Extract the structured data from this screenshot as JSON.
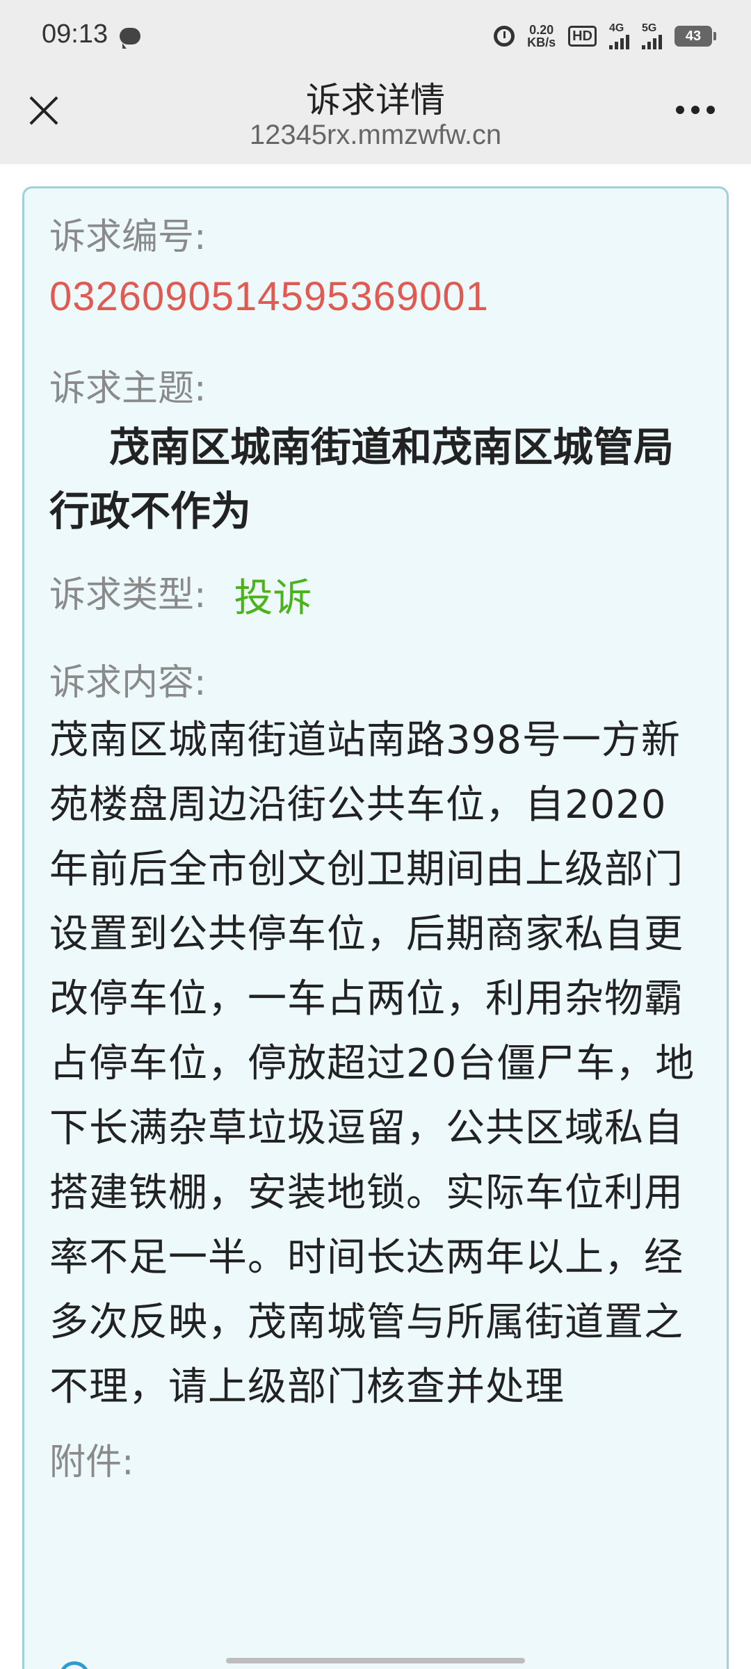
{
  "status_bar": {
    "time": "09:13",
    "net_speed_value": "0.20",
    "net_speed_unit": "KB/s",
    "hd": "HD",
    "sig1": "4G",
    "sig2": "5G",
    "battery": "43"
  },
  "nav": {
    "title": "诉求详情",
    "url": "12345rx.mmzwfw.cn"
  },
  "detail": {
    "number_label": "诉求编号:",
    "number_value": "0326090514595369001",
    "subject_label": "诉求主题:",
    "subject_value": "茂南区城南街道和茂南区城管局行政不作为",
    "type_label": "诉求类型:",
    "type_value": "投诉",
    "content_label": "诉求内容:",
    "content_value": "茂南区城南街道站南路398号一方新苑楼盘周边沿街公共车位，自2020年前后全市创文创卫期间由上级部门设置到公共停车位，后期商家私自更改停车位，一车占两位，利用杂物霸占停车位，停放超过20台僵尸车，地下长满杂草垃圾逗留，公共区域私自搭建铁棚，安装地锁。实际车位利用率不足一半。时间长达两年以上，经多次反映，茂南城管与所属街道置之不理，请上级部门核查并处理",
    "attachment_label": "附件:"
  },
  "colors": {
    "number": "#e05a52",
    "type": "#4ab31a",
    "card_bg": "#eef9fc",
    "card_border": "#9fd0dc"
  },
  "icons": {
    "close": "close-icon",
    "more": "more-icon",
    "attachment": "attachment-icon"
  }
}
